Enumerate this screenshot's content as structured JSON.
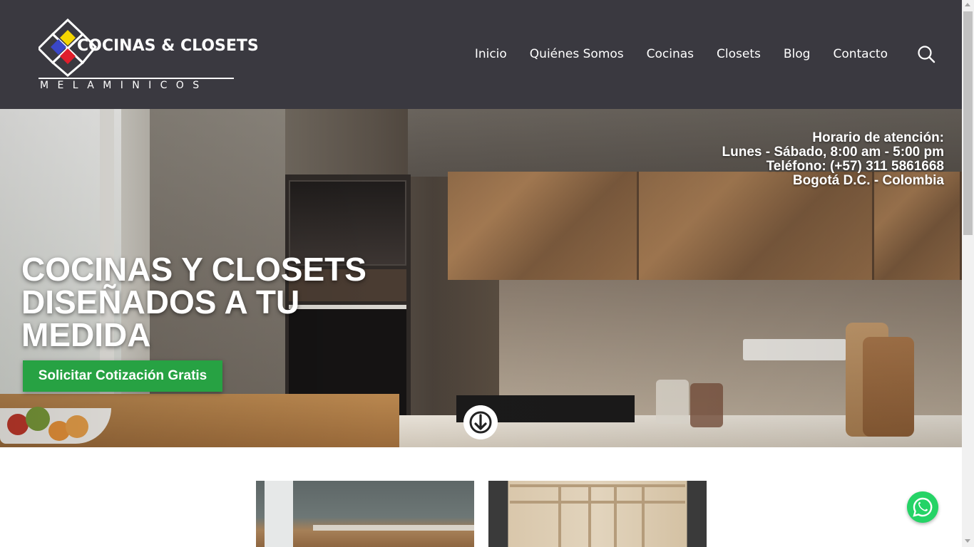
{
  "logo": {
    "title": "COCINAS & CLOSETS",
    "subtitle": "MELAMINICOS",
    "colors": {
      "yellow": "#f4d600",
      "blue": "#3a47c8",
      "red": "#e01e2b"
    }
  },
  "nav": {
    "items": [
      {
        "label": "Inicio"
      },
      {
        "label": "Quiénes Somos"
      },
      {
        "label": "Cocinas"
      },
      {
        "label": "Closets"
      },
      {
        "label": "Blog"
      },
      {
        "label": "Contacto"
      }
    ],
    "search_icon": "search-icon"
  },
  "hero": {
    "hours_lines": [
      "Horario de atención:",
      "Lunes - Sábado, 8:00 am - 5:00 pm",
      "Teléfono: (+57) 311 5861668",
      "Bogotá D.C. - Colombia"
    ],
    "title_lines": [
      "COCINAS Y CLOSETS",
      "DISEÑADOS A TU",
      "MEDIDA"
    ],
    "cta_label": "Solicitar Cotización Gratis",
    "scroll_icon": "arrow-down-circle-icon"
  },
  "colors": {
    "header_bg": "#3a3940",
    "cta_bg": "#27a243",
    "whatsapp": "#25d366"
  },
  "floating": {
    "whatsapp_icon": "whatsapp-icon"
  }
}
